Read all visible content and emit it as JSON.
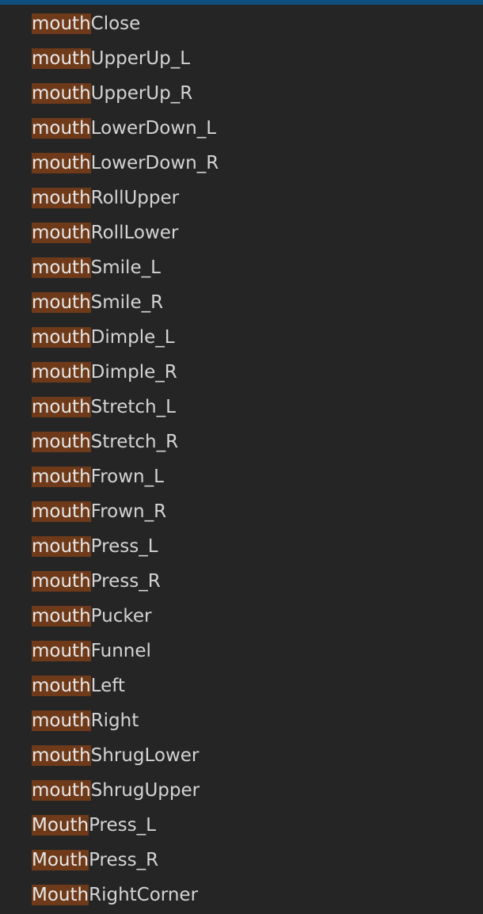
{
  "colors": {
    "background": "#252526",
    "top_border": "#0e4f7e",
    "highlight": "#6e3a1a",
    "text": "#d4d4d4"
  },
  "items": [
    {
      "highlight": "mouth",
      "rest": "Close"
    },
    {
      "highlight": "mouth",
      "rest": "UpperUp_L"
    },
    {
      "highlight": "mouth",
      "rest": "UpperUp_R"
    },
    {
      "highlight": "mouth",
      "rest": "LowerDown_L"
    },
    {
      "highlight": "mouth",
      "rest": "LowerDown_R"
    },
    {
      "highlight": "mouth",
      "rest": "RollUpper"
    },
    {
      "highlight": "mouth",
      "rest": "RollLower"
    },
    {
      "highlight": "mouth",
      "rest": "Smile_L"
    },
    {
      "highlight": "mouth",
      "rest": "Smile_R"
    },
    {
      "highlight": "mouth",
      "rest": "Dimple_L"
    },
    {
      "highlight": "mouth",
      "rest": "Dimple_R"
    },
    {
      "highlight": "mouth",
      "rest": "Stretch_L"
    },
    {
      "highlight": "mouth",
      "rest": "Stretch_R"
    },
    {
      "highlight": "mouth",
      "rest": "Frown_L"
    },
    {
      "highlight": "mouth",
      "rest": "Frown_R"
    },
    {
      "highlight": "mouth",
      "rest": "Press_L"
    },
    {
      "highlight": "mouth",
      "rest": "Press_R"
    },
    {
      "highlight": "mouth",
      "rest": "Pucker"
    },
    {
      "highlight": "mouth",
      "rest": "Funnel"
    },
    {
      "highlight": "mouth",
      "rest": "Left"
    },
    {
      "highlight": "mouth",
      "rest": "Right"
    },
    {
      "highlight": "mouth",
      "rest": "ShrugLower"
    },
    {
      "highlight": "mouth",
      "rest": "ShrugUpper"
    },
    {
      "highlight": "Mouth",
      "rest": "Press_L"
    },
    {
      "highlight": "Mouth",
      "rest": "Press_R"
    },
    {
      "highlight": "Mouth",
      "rest": "RightCorner"
    }
  ]
}
